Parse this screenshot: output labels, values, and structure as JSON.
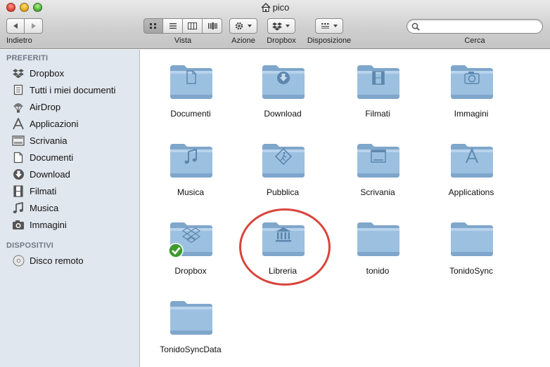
{
  "window": {
    "title": "pico",
    "home_icon": "house-icon"
  },
  "toolbar": {
    "back_label": "Indietro",
    "view_label": "Vista",
    "action_label": "Azione",
    "dropbox_label": "Dropbox",
    "arrange_label": "Disposizione",
    "search_label": "Cerca",
    "search_value": ""
  },
  "sidebar": {
    "favorites_header": "PREFERITI",
    "favorites": [
      {
        "label": "Dropbox",
        "icon": "dropbox-icon"
      },
      {
        "label": "Tutti i miei documenti",
        "icon": "all-documents-icon"
      },
      {
        "label": "AirDrop",
        "icon": "airdrop-icon"
      },
      {
        "label": "Applicazioni",
        "icon": "applications-icon"
      },
      {
        "label": "Scrivania",
        "icon": "desktop-icon"
      },
      {
        "label": "Documenti",
        "icon": "document-icon"
      },
      {
        "label": "Download",
        "icon": "download-icon"
      },
      {
        "label": "Filmati",
        "icon": "film-icon"
      },
      {
        "label": "Musica",
        "icon": "music-icon"
      },
      {
        "label": "Immagini",
        "icon": "camera-icon"
      }
    ],
    "devices_header": "DISPOSITIVI",
    "devices": [
      {
        "label": "Disco remoto",
        "icon": "disc-icon"
      }
    ]
  },
  "files": [
    {
      "label": "Documenti",
      "emblem": "document"
    },
    {
      "label": "Download",
      "emblem": "download"
    },
    {
      "label": "Filmati",
      "emblem": "film"
    },
    {
      "label": "Immagini",
      "emblem": "camera"
    },
    {
      "label": "Musica",
      "emblem": "music"
    },
    {
      "label": "Pubblica",
      "emblem": "public"
    },
    {
      "label": "Scrivania",
      "emblem": "desktop"
    },
    {
      "label": "Applications",
      "emblem": "apps"
    },
    {
      "label": "Dropbox",
      "emblem": "dropbox"
    },
    {
      "label": "Libreria",
      "emblem": "library"
    },
    {
      "label": "tonido",
      "emblem": "none"
    },
    {
      "label": "TonidoSync",
      "emblem": "none"
    },
    {
      "label": "TonidoSyncData",
      "emblem": "none"
    }
  ],
  "colors": {
    "folder": "#8fb4d6",
    "annotation": "#d8453d",
    "sidebar_bg": "#e1e7ef"
  }
}
